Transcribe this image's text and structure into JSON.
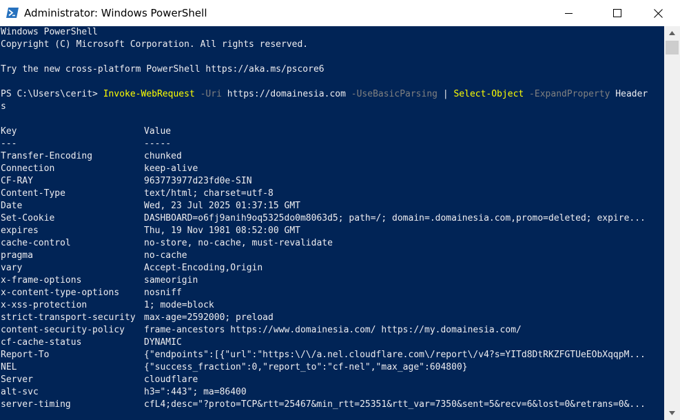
{
  "window": {
    "title": "Administrator: Windows PowerShell",
    "icons": [
      "powershell-icon",
      "minimize-icon",
      "maximize-icon",
      "close-icon",
      "scroll-up-icon",
      "scroll-down-icon"
    ]
  },
  "console": {
    "banner": [
      "Windows PowerShell",
      "Copyright (C) Microsoft Corporation. All rights reserved.",
      "",
      "Try the new cross-platform PowerShell https://aka.ms/pscore6",
      ""
    ],
    "command": {
      "prompt": "PS C:\\Users\\cerit> ",
      "cmdlet1": "Invoke-WebRequest",
      "param1": " -Uri",
      "arg1": " https://domainesia.com",
      "param2": " -UseBasicParsing",
      "pipe": " | ",
      "cmdlet2": "Select-Object",
      "param3": " -ExpandProperty",
      "arg3": " Header",
      "wrap": "s"
    },
    "table": {
      "header_key": "Key",
      "header_value": "Value",
      "sep_key": "---",
      "sep_value": "-----",
      "rows": [
        {
          "key": "Transfer-Encoding",
          "value": "chunked"
        },
        {
          "key": "Connection",
          "value": "keep-alive"
        },
        {
          "key": "CF-RAY",
          "value": "963773977d23fd0e-SIN"
        },
        {
          "key": "Content-Type",
          "value": "text/html; charset=utf-8"
        },
        {
          "key": "Date",
          "value": "Wed, 23 Jul 2025 01:37:15 GMT"
        },
        {
          "key": "Set-Cookie",
          "value": "DASHBOARD=o6fj9anih9oq5325do0m8063d5; path=/; domain=.domainesia.com,promo=deleted; expire..."
        },
        {
          "key": "expires",
          "value": "Thu, 19 Nov 1981 08:52:00 GMT"
        },
        {
          "key": "cache-control",
          "value": "no-store, no-cache, must-revalidate"
        },
        {
          "key": "pragma",
          "value": "no-cache"
        },
        {
          "key": "vary",
          "value": "Accept-Encoding,Origin"
        },
        {
          "key": "x-frame-options",
          "value": "sameorigin"
        },
        {
          "key": "x-content-type-options",
          "value": "nosniff"
        },
        {
          "key": "x-xss-protection",
          "value": "1; mode=block"
        },
        {
          "key": "strict-transport-security",
          "value": "max-age=2592000; preload"
        },
        {
          "key": "content-security-policy",
          "value": "frame-ancestors https://www.domainesia.com/ https://my.domainesia.com/"
        },
        {
          "key": "cf-cache-status",
          "value": "DYNAMIC"
        },
        {
          "key": "Report-To",
          "value": "{\"endpoints\":[{\"url\":\"https:\\/\\/a.nel.cloudflare.com\\/report\\/v4?s=YITd8DtRKZFGTUeEObXqqpM..."
        },
        {
          "key": "NEL",
          "value": "{\"success_fraction\":0,\"report_to\":\"cf-nel\",\"max_age\":604800}"
        },
        {
          "key": "Server",
          "value": "cloudflare"
        },
        {
          "key": "alt-svc",
          "value": "h3=\":443\"; ma=86400"
        },
        {
          "key": "server-timing",
          "value": "cfL4;desc=\"?proto=TCP&rtt=25467&min_rtt=25351&rtt_var=7350&sent=5&recv=6&lost=0&retrans=0&..."
        }
      ]
    }
  },
  "colors": {
    "console_bg": "#012456",
    "console_fg": "#eeedf0",
    "cmdlet": "#ffff00",
    "parameter": "#808080"
  }
}
